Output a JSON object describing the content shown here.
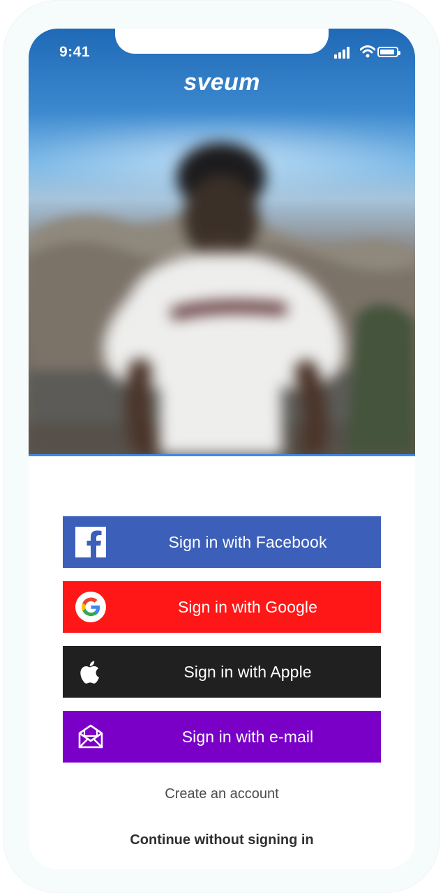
{
  "status_bar": {
    "time": "9:41"
  },
  "brand": {
    "name": "sveum"
  },
  "hero": {
    "image_label": "person-photo"
  },
  "signin": {
    "facebook_label": "Sign in with Facebook",
    "google_label": "Sign in with Google",
    "apple_label": "Sign in with Apple",
    "email_label": "Sign in with e-mail"
  },
  "links": {
    "create_account": "Create an account",
    "continue_without_signing_in": "Continue without signing in"
  },
  "colors": {
    "facebook": "#3c5fb9",
    "google": "#ff1717",
    "apple": "#202020",
    "email": "#7a00c8",
    "hero_accent": "#3d88e7"
  },
  "icons": {
    "signal": "signal-icon",
    "wifi": "wifi-icon",
    "battery": "battery-icon",
    "facebook": "facebook-icon",
    "google": "google-icon",
    "apple": "apple-icon",
    "email": "email-icon"
  }
}
